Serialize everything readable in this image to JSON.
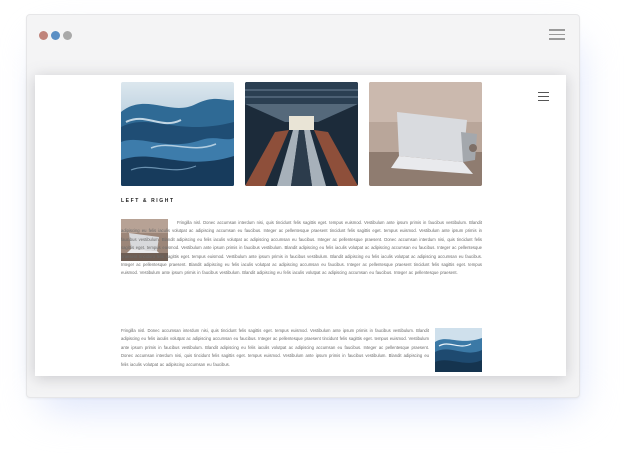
{
  "window": {
    "controls": [
      "close",
      "minimize",
      "maximize"
    ],
    "menu_icon": "hamburger-icon"
  },
  "page": {
    "menu_icon": "hamburger-icon",
    "gallery": [
      {
        "subject": "ocean wave",
        "icon": "photo-wave"
      },
      {
        "subject": "escalators",
        "icon": "photo-escalator"
      },
      {
        "subject": "laptop on desk",
        "icon": "photo-laptop"
      }
    ],
    "section_title": "LEFT & RIGHT",
    "paragraph_1": "Fringilla nisl. Donec accumsan interdum nisi, quis tincidunt felis sagittis eget. tempus euismod. Vestibulum ante ipsum primis in faucibus vestibulum. Blandit adipiscing eu felis iaculis volutpat ac adipiscing accumsan eu faucibus. Integer ac pellentesque praesent tincidunt felis sagittis eget. tempus euismod. Vestibulum ante ipsum primis in faucibus vestibulum. Blandit adipiscing eu felis iaculis volutpat ac adipiscing accumsan eu faucibus. Integer ac pellentesque praesent. Donec accumsan interdum nisi, quis tincidunt felis sagittis eget. tempus euismod. Vestibulum ante ipsum primis in faucibus vestibulum. Blandit adipiscing eu felis iaculis volutpat ac adipiscing accumsan eu faucibus. Integer ac pellentesque praesent tincidunt felis sagittis eget. tempus euismod. Vestibulum ante ipsum primis in faucibus vestibulum. Blandit adipiscing eu felis iaculis volutpat ac adipiscing accumsan eu faucibus. Integer ac pellentesque praesent. Blandit adipiscing eu felis iaculis volutpat ac adipiscing accumsan eu faucibus. Integer ac pellentesque praesent tincidunt felis sagittis eget. tempus euismod. Vestibulum ante ipsum primis in faucibus vestibulum. Blandit adipiscing eu felis iaculis volutpat ac adipiscing accumsan eu faucibus. Integer ac pellentesque praesent.",
    "paragraph_2": "Fringilla nisl. Donec accumsan interdum nisi, quis tincidunt felis sagittis eget. tempus euismod. Vestibulum ante ipsum primis in faucibus vestibulum. Blandit adipiscing eu felis iaculis volutpat ac adipiscing accumsan eu faucibus. Integer ac pellentesque praesent tincidunt felis sagittis eget. tempus euismod. Vestibulum ante ipsum primis in faucibus vestibulum. Blandit adipiscing eu felis iaculis volutpat ac adipiscing accumsan eu faucibus. Integer ac pellentesque praesent. Donec accumsan interdum nisi, quis tincidunt felis sagittis eget. tempus euismod. Vestibulum ante ipsum primis in faucibus vestibulum. Blandit adipiscing eu felis iaculis volutpat ac adipiscing accumsan eu faucibus."
  },
  "colors": {
    "window_dot_red": "#c0847b",
    "window_dot_blue": "#5b8fc4",
    "window_dot_gray": "#a9a9a9",
    "text": "#6a6a6a",
    "heading": "#222222"
  }
}
